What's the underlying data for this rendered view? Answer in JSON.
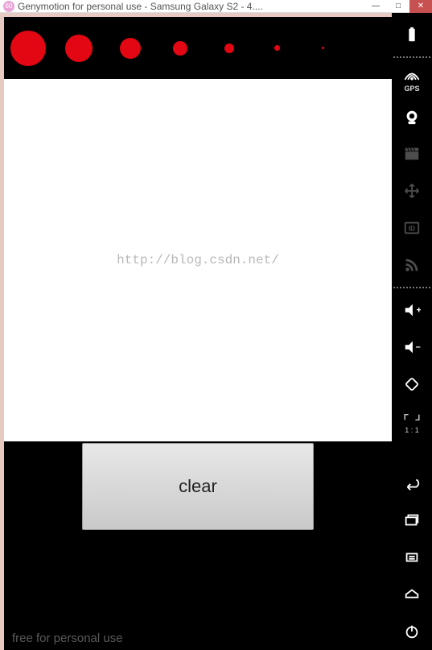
{
  "titlebar": {
    "icon_label": "60",
    "title": "Genymotion for personal use - Samsung Galaxy S2 - 4....",
    "min": "—",
    "max": "□",
    "close": "✕"
  },
  "brush_bar": {
    "sizes": [
      44,
      34,
      26,
      18,
      12,
      7,
      3
    ]
  },
  "canvas": {
    "watermark": "http://blog.csdn.net/"
  },
  "actions": {
    "clear_label": "clear"
  },
  "footer": {
    "text": "free for personal use"
  },
  "sidebar": {
    "battery": "battery-icon",
    "gps": "GPS",
    "camera": "camera-icon",
    "capture": "clapper-icon",
    "move": "move-icon",
    "id": "ID",
    "signal": "rss-icon",
    "vol_up": "volume-up-icon",
    "vol_down": "volume-down-icon",
    "rotate": "rotate-icon",
    "scale": "1 : 1",
    "back": "back-icon",
    "recent": "recent-icon",
    "menu": "menu-icon",
    "home": "home-icon",
    "power": "power-icon"
  }
}
